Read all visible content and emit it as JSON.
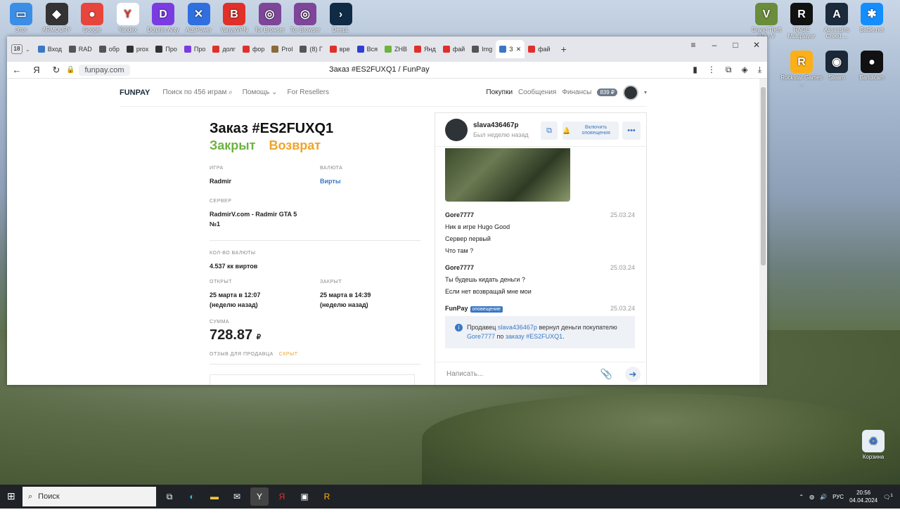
{
  "desktop": {
    "icons_left": [
      {
        "label": "Этот",
        "color": "#3a8ee6",
        "glyph": "▭"
      },
      {
        "label": "ARMOURY",
        "color": "#333",
        "glyph": "◆"
      },
      {
        "label": "Google",
        "color": "#e8453c",
        "glyph": "●"
      },
      {
        "label": "Yandex",
        "color": "#fff",
        "glyph": "Y"
      },
      {
        "label": "Dolphin Anty",
        "color": "#7a3ce0",
        "glyph": "D"
      },
      {
        "label": "AdsPower",
        "color": "#2f6fe0",
        "glyph": "✕"
      },
      {
        "label": "VanyaVPN",
        "color": "#e0302a",
        "glyph": "B"
      },
      {
        "label": "Tor Browser",
        "color": "#7d4698",
        "glyph": "◎"
      },
      {
        "label": "Tor Browser",
        "color": "#7d4698",
        "glyph": "◎"
      },
      {
        "label": "DeepL",
        "color": "#0f2b46",
        "glyph": "›"
      }
    ],
    "icons_right": [
      {
        "label": "Grand Theft Auto V",
        "color": "#6b8c3a",
        "glyph": "V"
      },
      {
        "label": "RAGE Multiplayer",
        "color": "#111",
        "glyph": "R"
      },
      {
        "label": "Assassins Creed ...",
        "color": "#1c2b3b",
        "glyph": "A"
      },
      {
        "label": "Battle.net",
        "color": "#148eff",
        "glyph": "✱"
      },
      {
        "label": "Rockstar Games ...",
        "color": "#fcaf17",
        "glyph": "R"
      },
      {
        "label": "Steam",
        "color": "#1b2838",
        "glyph": "◉"
      },
      {
        "label": "Bandicam",
        "color": "#111",
        "glyph": "●"
      }
    ],
    "recycle_bin": "Корзина"
  },
  "browser": {
    "tab_count": "18",
    "tabs": [
      "Вход",
      "RAD",
      "обр",
      "prox",
      "Про",
      "Про",
      "долг",
      "фор",
      "Prol",
      "(8) Г",
      "вре",
      "Вся",
      "ZHB",
      "Янд",
      "фай",
      "Img",
      "З",
      "фай"
    ],
    "active_tab_index": 16,
    "url": "funpay.com",
    "page_title": "Заказ #ES2FUXQ1 / FunPay"
  },
  "header": {
    "logo": "FUNPAY",
    "search": "Поиск по 456 играм",
    "help": "Помощь",
    "resellers": "For Resellers",
    "purchases": "Покупки",
    "messages": "Сообщения",
    "finance": "Финансы",
    "balance": "839 ₽"
  },
  "order": {
    "title": "Заказ #ES2FUXQ1",
    "status_closed": "Закрыт",
    "status_refund": "Возврат",
    "game_label": "ИГРА",
    "game": "Radmir",
    "currency_label": "ВАЛЮТА",
    "currency": "Вирты",
    "server_label": "СЕРВЕР",
    "server": "RadmirV.com - Radmir GTA 5 №1",
    "amount_label": "КОЛ-ВО ВАЛЮТЫ",
    "amount": "4.537 кк виртов",
    "opened_label": "ОТКРЫТ",
    "opened": "25 марта в 12:07",
    "opened_ago": "(неделю назад)",
    "closed_label": "ЗАКРЫТ",
    "closed": "25 марта в 14:39",
    "closed_ago": "(неделю назад)",
    "sum_label": "СУММА",
    "sum": "728.87",
    "sum_currency": "₽",
    "review_label": "ОТЗЫВ ДЛЯ ПРОДАВЦА",
    "review_hidden": "СКРЫТ"
  },
  "chat": {
    "user": "slava436467p",
    "seen": "Был неделю назад",
    "notify_btn": "Включить оповещения",
    "messages": [
      {
        "author": "Gore7777",
        "date": "25.03.24",
        "lines": [
          "Ник в игре Hugo Good",
          "Сервер первый",
          "Что там ?"
        ]
      },
      {
        "author": "Gore7777",
        "date": "25.03.24",
        "lines": [
          "Ты будешь кидать деньги ?",
          "Если нет возвращай мне мои"
        ]
      }
    ],
    "system_author": "FunPay",
    "system_tag": "оповещение",
    "system_date": "25.03.24",
    "notice_p1": "Продавец ",
    "notice_seller": "slava436467p",
    "notice_p2": " вернул деньги покупателю ",
    "notice_buyer": "Gore7777",
    "notice_p3": " по ",
    "notice_order": "заказу #ES2FUXQ1",
    "notice_end": ".",
    "input_placeholder": "Написать..."
  },
  "taskbar": {
    "search": "Поиск",
    "lang": "РУС",
    "time": "20:56",
    "date": "04.04.2024",
    "notif_count": "1"
  },
  "colors": {
    "closed": "#6cb33f",
    "refund": "#f0a32a",
    "link": "#3a78c3"
  }
}
